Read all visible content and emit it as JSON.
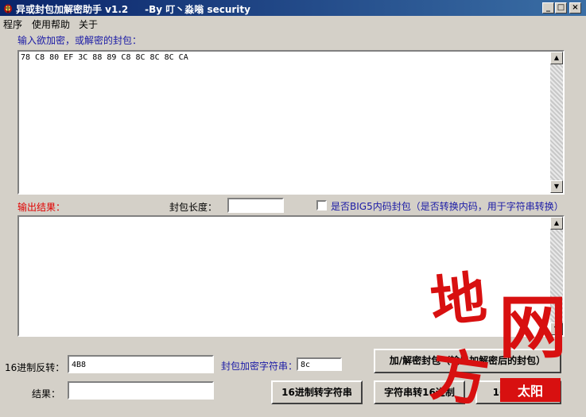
{
  "window": {
    "title": "异或封包加解密助手 v1.2     -By 叮丶淼嗡 security",
    "min_label": "_",
    "max_label": "□",
    "close_label": "×"
  },
  "menu": {
    "items": [
      "程序",
      "使用帮助",
      "关于"
    ]
  },
  "input_section": {
    "label": "输入欲加密，或解密的封包：",
    "value": "78 C8 80 EF 3C 88 89 C8 8C 8C 8C CA"
  },
  "output_section": {
    "label": "输出结果：",
    "length_label": "封包长度：",
    "length_value": "",
    "big5_label": "是否BIG5内码封包（是否转换内码，用于字符串转换）",
    "result_value": ""
  },
  "bottom": {
    "hex_reverse_label": "16进制反转：",
    "hex_reverse_value": "4B8",
    "key_label": "封包加密字符串：",
    "key_value": "8c",
    "result_label": "结果：",
    "result_value": "",
    "encrypt_button": "加/解密封包（输出加解密后的封包）",
    "hex_to_str_button": "16进制转字符串",
    "str_to_hex_button": "字符串转16进制",
    "other_button": "16进制反转"
  },
  "watermark": {
    "text": "地方网",
    "stamp": "太阳"
  },
  "colors": {
    "title_start": "#0a246a",
    "title_end": "#3a6ea5",
    "label_blue": "#1a1aa6",
    "label_red": "#e00000",
    "watermark_red": "#d81010"
  }
}
